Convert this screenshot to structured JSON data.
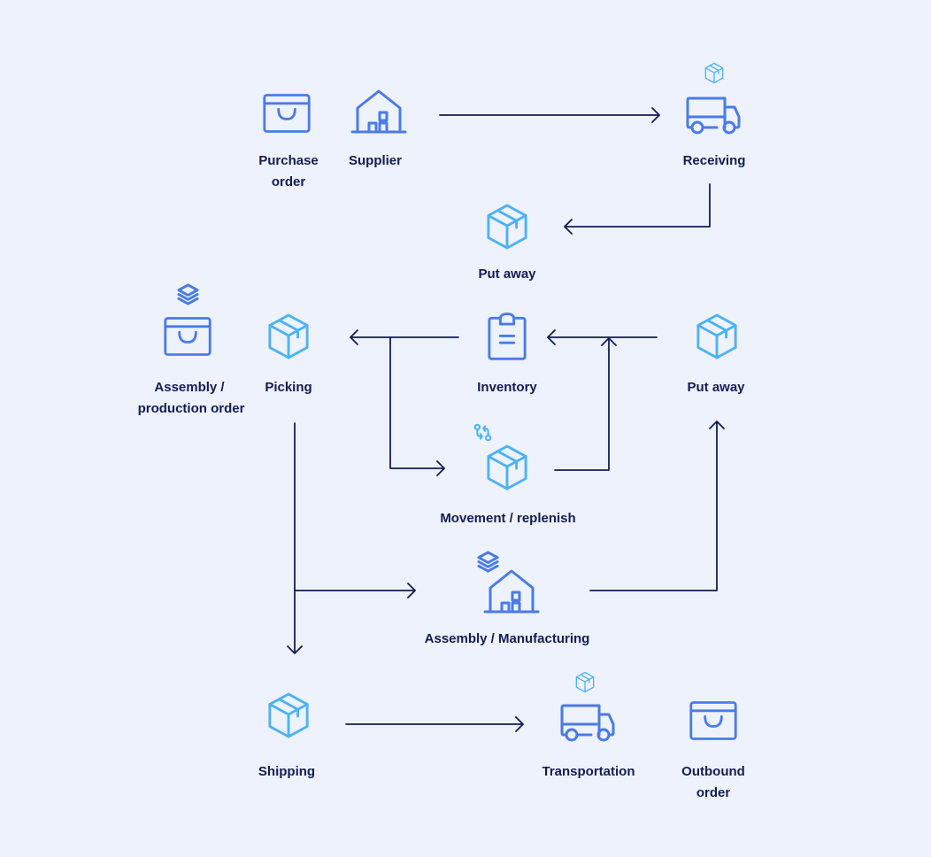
{
  "colors": {
    "background": "#edf2fc",
    "icon_primary": "#4a7be6",
    "icon_secondary": "#4db2f5",
    "text_and_arrows": "#141c52"
  },
  "nodes": {
    "purchase_order": {
      "line1": "Purchase",
      "line2": "order",
      "icon": "shopping-bag-icon"
    },
    "supplier": {
      "label": "Supplier",
      "icon": "warehouse-icon"
    },
    "receiving": {
      "label": "Receiving",
      "icon": "truck-icon",
      "badge_icon": "box-icon"
    },
    "put_away_1": {
      "label": "Put away",
      "icon": "box-icon"
    },
    "assembly_order": {
      "line1": "Assembly /",
      "line2": "production order",
      "icon": "shopping-bag-icon",
      "badge_icon": "layers-icon"
    },
    "picking": {
      "label": "Picking",
      "icon": "box-icon"
    },
    "inventory": {
      "label": "Inventory",
      "icon": "clipboard-icon"
    },
    "put_away_2": {
      "label": "Put away",
      "icon": "box-icon"
    },
    "movement": {
      "label": "Movement / replenish",
      "icon": "box-icon",
      "badge_icon": "swap-icon"
    },
    "assembly_manufacturing": {
      "label": "Assembly / Manufacturing",
      "icon": "warehouse-icon",
      "badge_icon": "layers-icon"
    },
    "shipping": {
      "label": "Shipping",
      "icon": "box-icon"
    },
    "transportation": {
      "label": "Transportation",
      "icon": "truck-icon",
      "badge_icon": "box-icon"
    },
    "outbound_order": {
      "line1": "Outbound",
      "line2": "order",
      "icon": "shopping-bag-icon"
    }
  },
  "edges": [
    {
      "from": "Supplier",
      "to": "Receiving"
    },
    {
      "from": "Receiving",
      "to": "Put away"
    },
    {
      "from": "Inventory",
      "to": "Picking"
    },
    {
      "from": "Inventory",
      "to": "Movement / replenish"
    },
    {
      "from": "Put away",
      "to": "Inventory"
    },
    {
      "from": "Movement / replenish",
      "to": "Inventory"
    },
    {
      "from": "Picking",
      "to": "Shipping"
    },
    {
      "from": "Picking",
      "to": "Assembly / Manufacturing"
    },
    {
      "from": "Assembly / Manufacturing",
      "to": "Put away"
    },
    {
      "from": "Shipping",
      "to": "Transportation"
    }
  ]
}
